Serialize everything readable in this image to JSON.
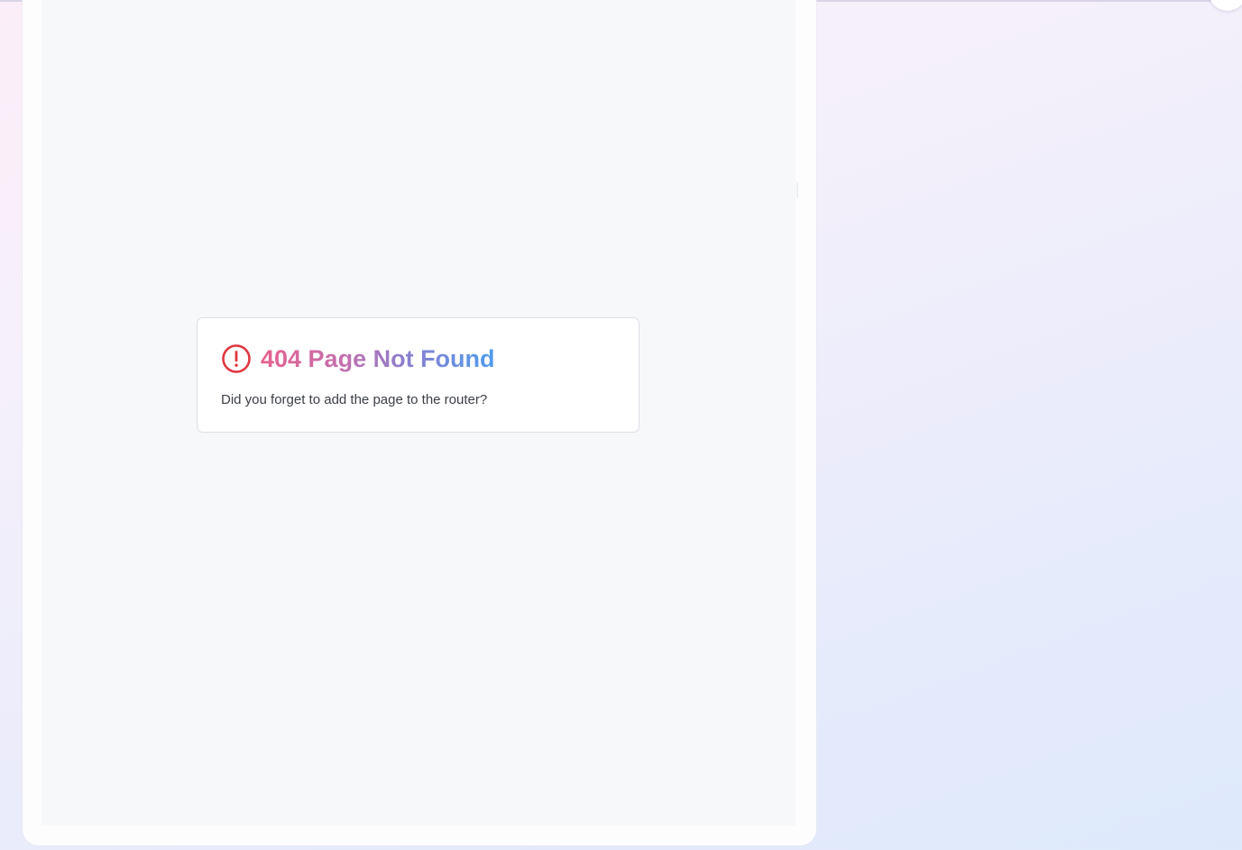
{
  "error": {
    "title": "404 Page Not Found",
    "message": "Did you forget to add the page to the router?",
    "icon": "alert-circle-icon"
  },
  "colors": {
    "icon": "#e0363f",
    "title_gradient": [
      "#e8608f",
      "#c46fae",
      "#8b7fcf",
      "#4f9bf0"
    ],
    "message": "#3b3f46",
    "card_border": "#dcdfe5",
    "canvas": "#f7f8fa"
  }
}
